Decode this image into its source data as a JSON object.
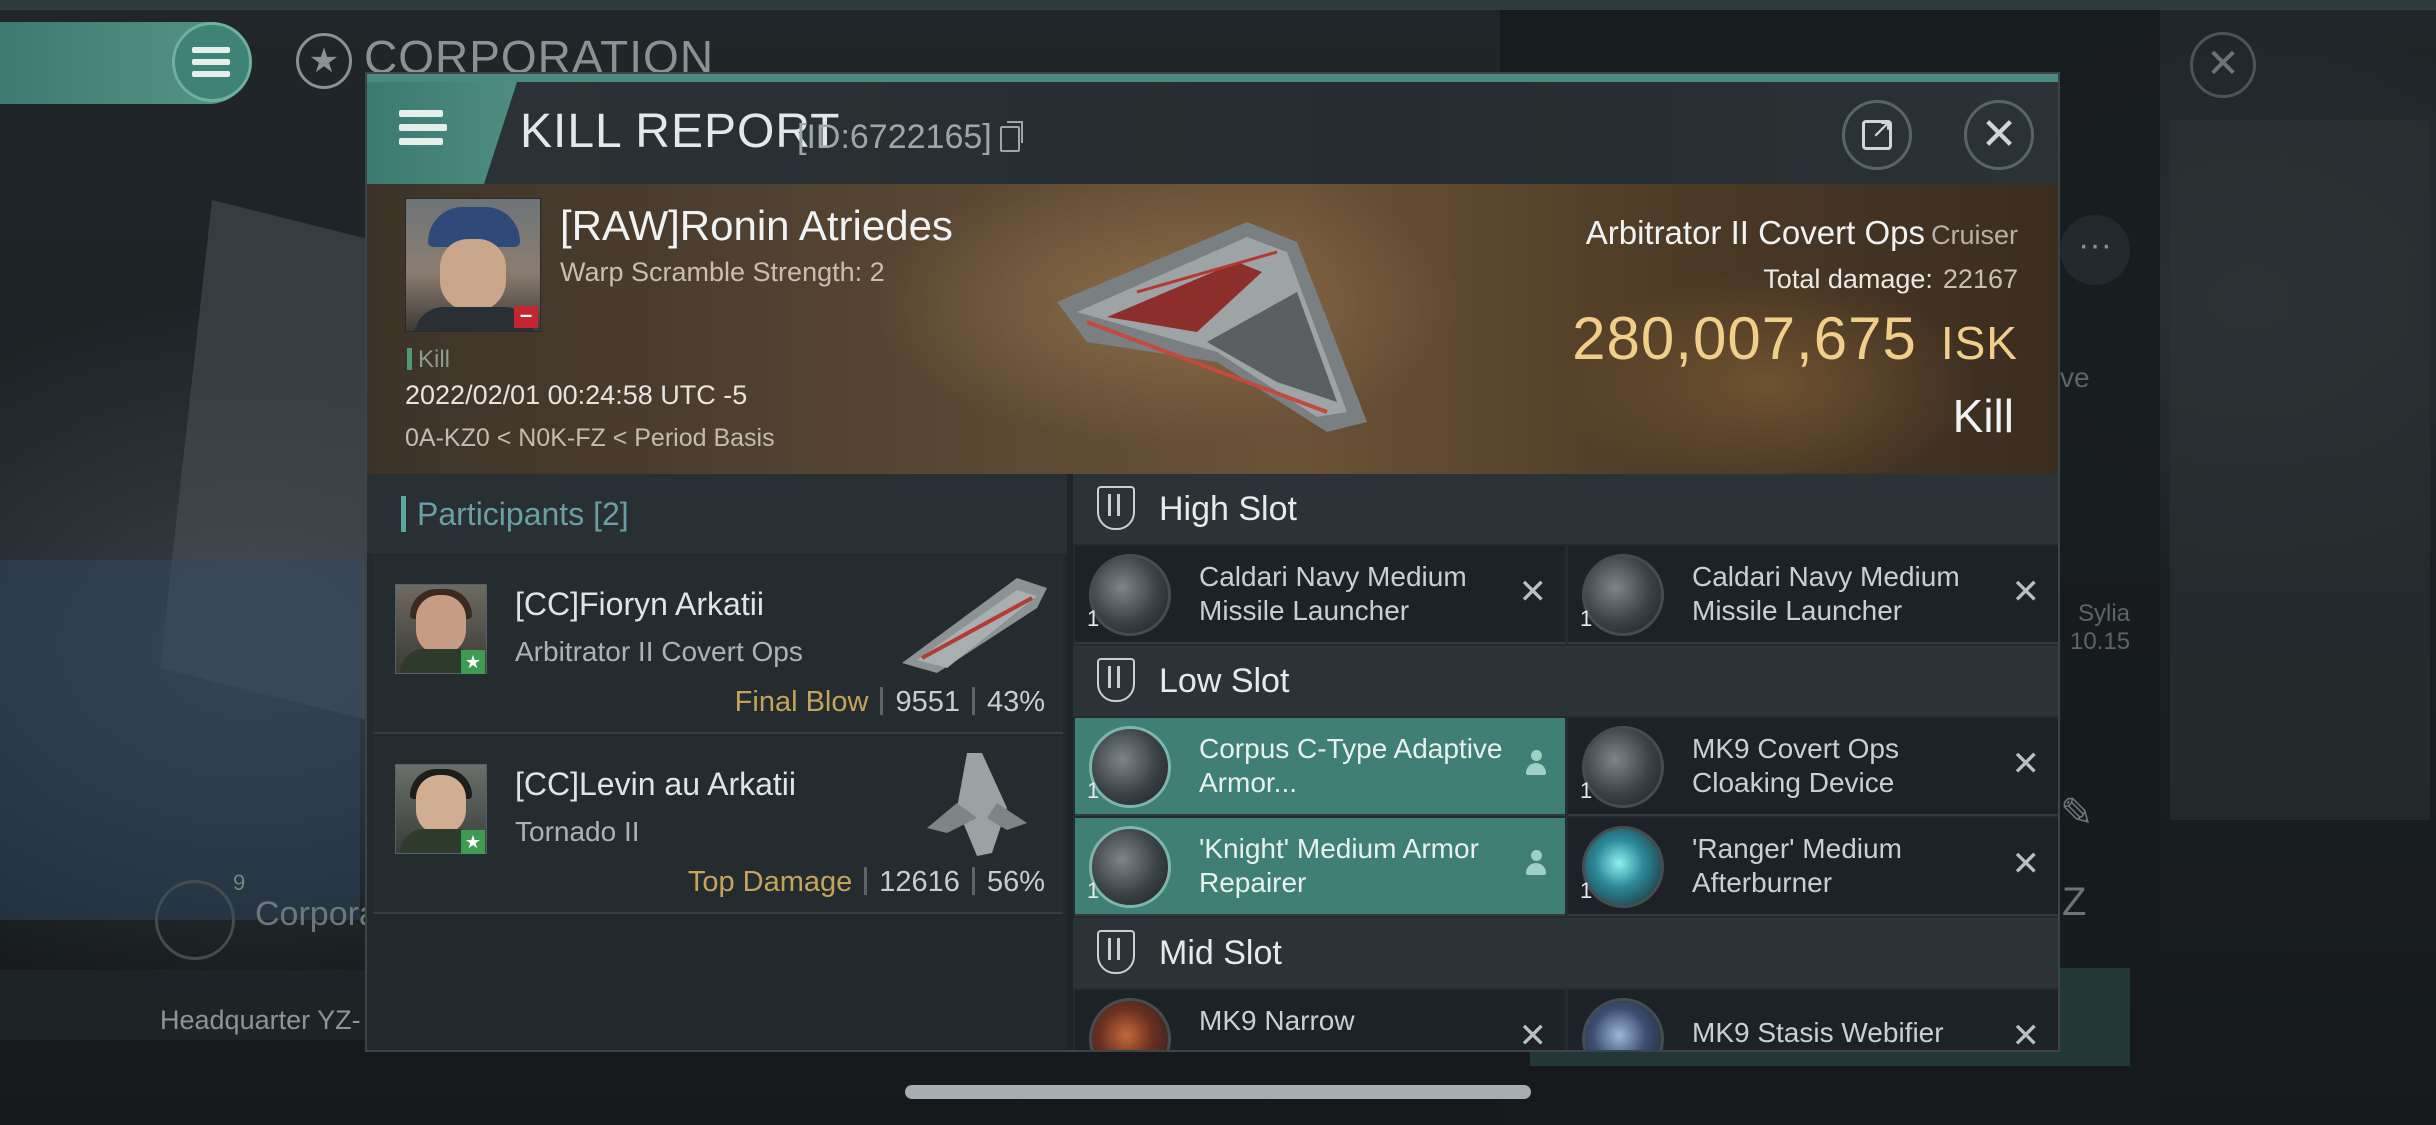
{
  "background": {
    "corp_title": "CORPORATION",
    "headquarter_text": "Headquarter YZ-",
    "corp_row_label": "Corpora",
    "corp_badge": "9",
    "faint_right_1": "ve",
    "faint_right_2": "Sylia",
    "faint_right_3": "10.15"
  },
  "header": {
    "title": "KILL REPORT",
    "id": "[ID:6722165]"
  },
  "victim": {
    "pilot": "[RAW]Ronin Atriedes",
    "warp_scramble": "Warp Scramble Strength: 2",
    "tag": "Kill",
    "datetime": "2022/02/01 00:24:58 UTC -5",
    "location": "0A-KZ0 < N0K-FZ < Period Basis",
    "ship": "Arbitrator II Covert Ops",
    "ship_class": "Cruiser",
    "total_damage_label": "Total damage:",
    "total_damage": "22167",
    "isk_value": "280,007,675",
    "isk_unit": "ISK",
    "result": "Kill"
  },
  "participants": {
    "title": "Participants",
    "count": "[2]",
    "items": [
      {
        "name": "[CC]Fioryn Arkatii",
        "ship": "Arbitrator II Covert Ops",
        "role": "Final Blow",
        "damage": "9551",
        "percent": "43%"
      },
      {
        "name": "[CC]Levin au Arkatii",
        "ship": "Tornado II",
        "role": "Top Damage",
        "damage": "12616",
        "percent": "56%"
      }
    ]
  },
  "fitting": {
    "high_slot": {
      "title": "High Slot",
      "modules": [
        {
          "qty": "1",
          "name": "Caldari Navy Medium Missile Launcher"
        },
        {
          "qty": "1",
          "name": "Caldari Navy Medium Missile Launcher"
        }
      ]
    },
    "low_slot": {
      "title": "Low Slot",
      "modules": [
        {
          "qty": "1",
          "name": "Corpus C-Type Adaptive Armor..."
        },
        {
          "qty": "1",
          "name": "MK9 Covert Ops Cloaking Device"
        },
        {
          "qty": "1",
          "name": "'Knight' Medium Armor Repairer"
        },
        {
          "qty": "1",
          "name": "'Ranger' Medium Afterburner"
        }
      ]
    },
    "mid_slot": {
      "title": "Mid Slot",
      "modules": [
        {
          "qty": "1",
          "name": "MK9 Narrow"
        },
        {
          "qty": "1",
          "name": "MK9 Stasis Webifier"
        }
      ]
    }
  },
  "icons": {
    "menu": "hamburger-icon",
    "copy": "copy-icon",
    "share": "share-icon",
    "close": "close-icon",
    "slot": "slot-shield-icon",
    "dropped": "person-icon",
    "destroyed": "x-icon"
  },
  "colors": {
    "accent_teal": "#4b8a80",
    "isk_gold": "#f0cf8a",
    "final_blow": "#c7a35a",
    "highlight_module": "#3f7f76",
    "participants_title": "#6a9fa6"
  }
}
